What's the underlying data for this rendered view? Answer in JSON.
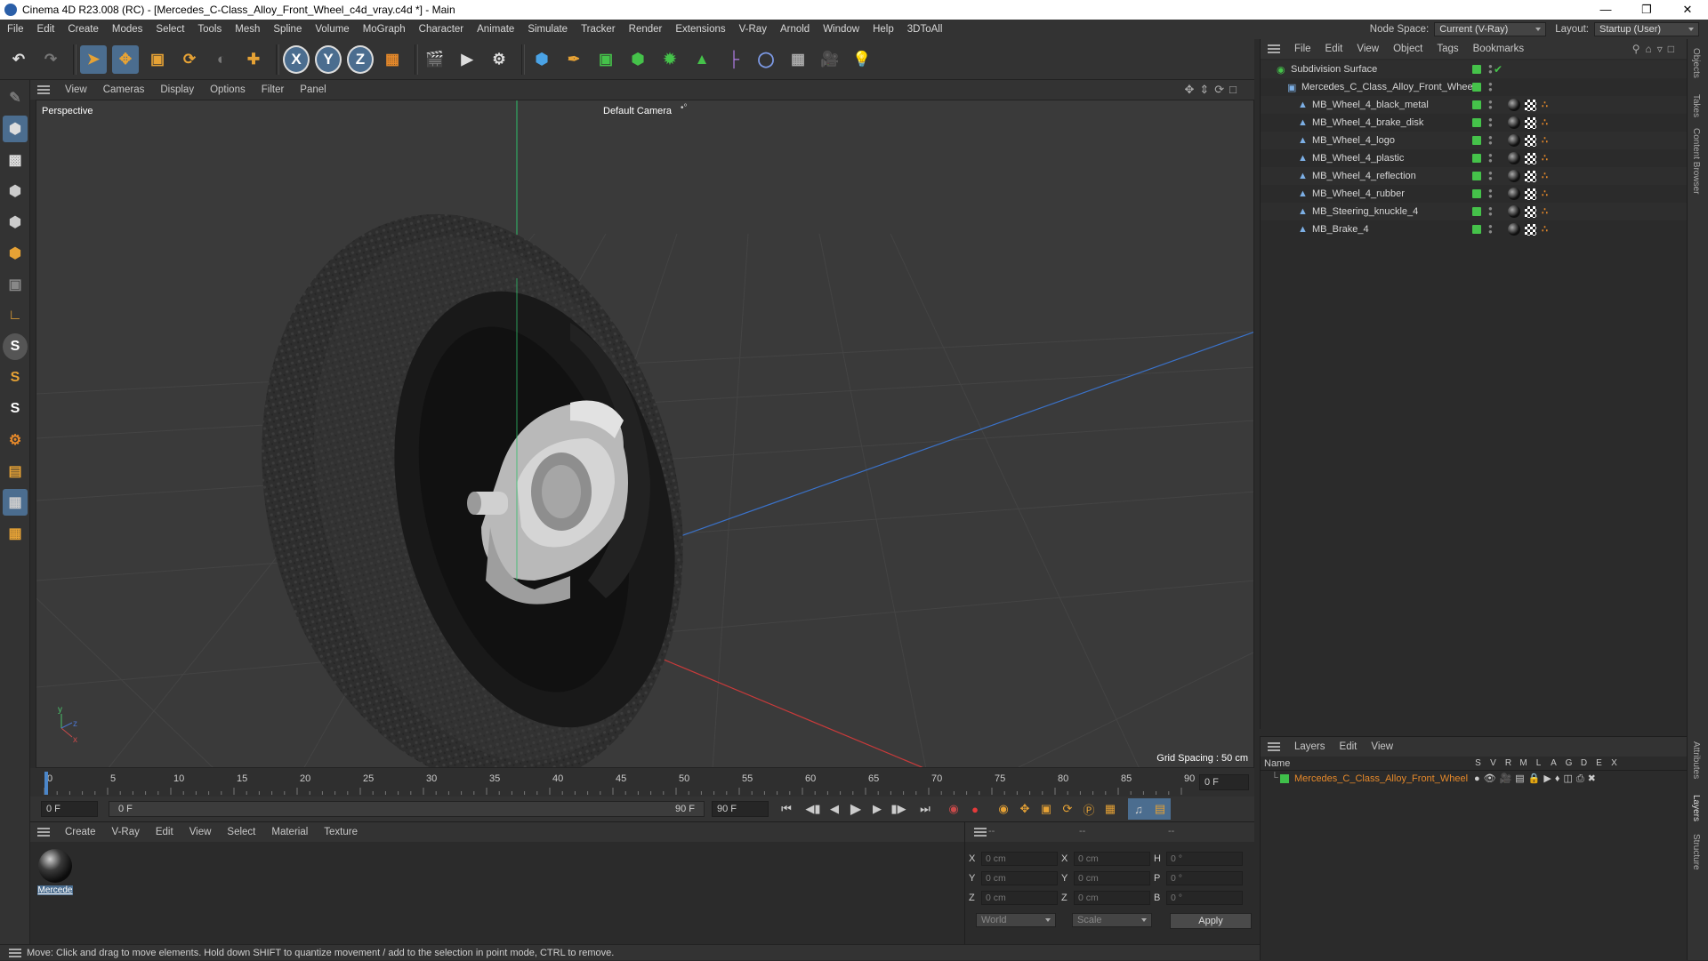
{
  "window": {
    "title": "Cinema 4D R23.008 (RC) - [Mercedes_C-Class_Alloy_Front_Wheel_c4d_vray.c4d *] - Main"
  },
  "menubar": {
    "items": [
      "File",
      "Edit",
      "Create",
      "Modes",
      "Select",
      "Tools",
      "Mesh",
      "Spline",
      "Volume",
      "MoGraph",
      "Character",
      "Animate",
      "Simulate",
      "Tracker",
      "Render",
      "Extensions",
      "V-Ray",
      "Arnold",
      "Window",
      "Help",
      "3DToAll"
    ],
    "node_space_label": "Node Space:",
    "node_space_value": "Current (V-Ray)",
    "layout_label": "Layout:",
    "layout_value": "Startup (User)"
  },
  "viewport": {
    "menu": [
      "View",
      "Cameras",
      "Display",
      "Options",
      "Filter",
      "Panel"
    ],
    "view_name": "Perspective",
    "camera": "Default Camera",
    "grid_spacing": "Grid Spacing : 50 cm"
  },
  "timeline": {
    "ticks": [
      "0",
      "5",
      "10",
      "15",
      "20",
      "25",
      "30",
      "35",
      "40",
      "45",
      "50",
      "55",
      "60",
      "65",
      "70",
      "75",
      "80",
      "85",
      "90"
    ],
    "end_frame": "0 F",
    "start_field": "0 F",
    "range_start": "0 F",
    "range_end": "90 F",
    "max_field": "90 F"
  },
  "material_panel": {
    "menu": [
      "Create",
      "V-Ray",
      "Edit",
      "View",
      "Select",
      "Material",
      "Texture"
    ],
    "material_name": "Mercede"
  },
  "attributes": {
    "col_headers": [
      "--",
      "--",
      "--"
    ],
    "rows": [
      {
        "l1": "X",
        "v1": "0 cm",
        "l2": "X",
        "v2": "0 cm",
        "l3": "H",
        "v3": "0 °"
      },
      {
        "l1": "Y",
        "v1": "0 cm",
        "l2": "Y",
        "v2": "0 cm",
        "l3": "P",
        "v3": "0 °"
      },
      {
        "l1": "Z",
        "v1": "0 cm",
        "l2": "Z",
        "v2": "0 cm",
        "l3": "B",
        "v3": "0 °"
      }
    ],
    "coord_system": "World",
    "mode": "Scale",
    "apply": "Apply"
  },
  "status": {
    "text": "Move: Click and drag to move elements. Hold down SHIFT to quantize movement / add to the selection in point mode, CTRL to remove."
  },
  "objects_panel": {
    "menu": [
      "File",
      "Edit",
      "View",
      "Object",
      "Tags",
      "Bookmarks"
    ],
    "items": [
      {
        "name": "Subdivision Surface",
        "indent": 0
      },
      {
        "name": "Mercedes_C_Class_Alloy_Front_Wheel",
        "indent": 1
      },
      {
        "name": "MB_Wheel_4_black_metal",
        "indent": 2
      },
      {
        "name": "MB_Wheel_4_brake_disk",
        "indent": 2
      },
      {
        "name": "MB_Wheel_4_logo",
        "indent": 2
      },
      {
        "name": "MB_Wheel_4_plastic",
        "indent": 2
      },
      {
        "name": "MB_Wheel_4_reflection",
        "indent": 2
      },
      {
        "name": "MB_Wheel_4_rubber",
        "indent": 2
      },
      {
        "name": "MB_Steering_knuckle_4",
        "indent": 2
      },
      {
        "name": "MB_Brake_4",
        "indent": 2
      }
    ]
  },
  "layers_panel": {
    "menu": [
      "Layers",
      "Edit",
      "View"
    ],
    "name_header": "Name",
    "flag_headers": [
      "S",
      "V",
      "R",
      "M",
      "L",
      "A",
      "G",
      "D",
      "E",
      "X"
    ],
    "layer_name": "Mercedes_C_Class_Alloy_Front_Wheel",
    "layer_color": "#3fbf4a"
  },
  "side_tabs": [
    "Objects",
    "Takes",
    "Content Browser",
    "Attributes",
    "Layers",
    "Structure"
  ],
  "colors": {
    "accent": "#4b6d8f",
    "layer_text": "#e6892a",
    "active_green": "#45c24a"
  }
}
